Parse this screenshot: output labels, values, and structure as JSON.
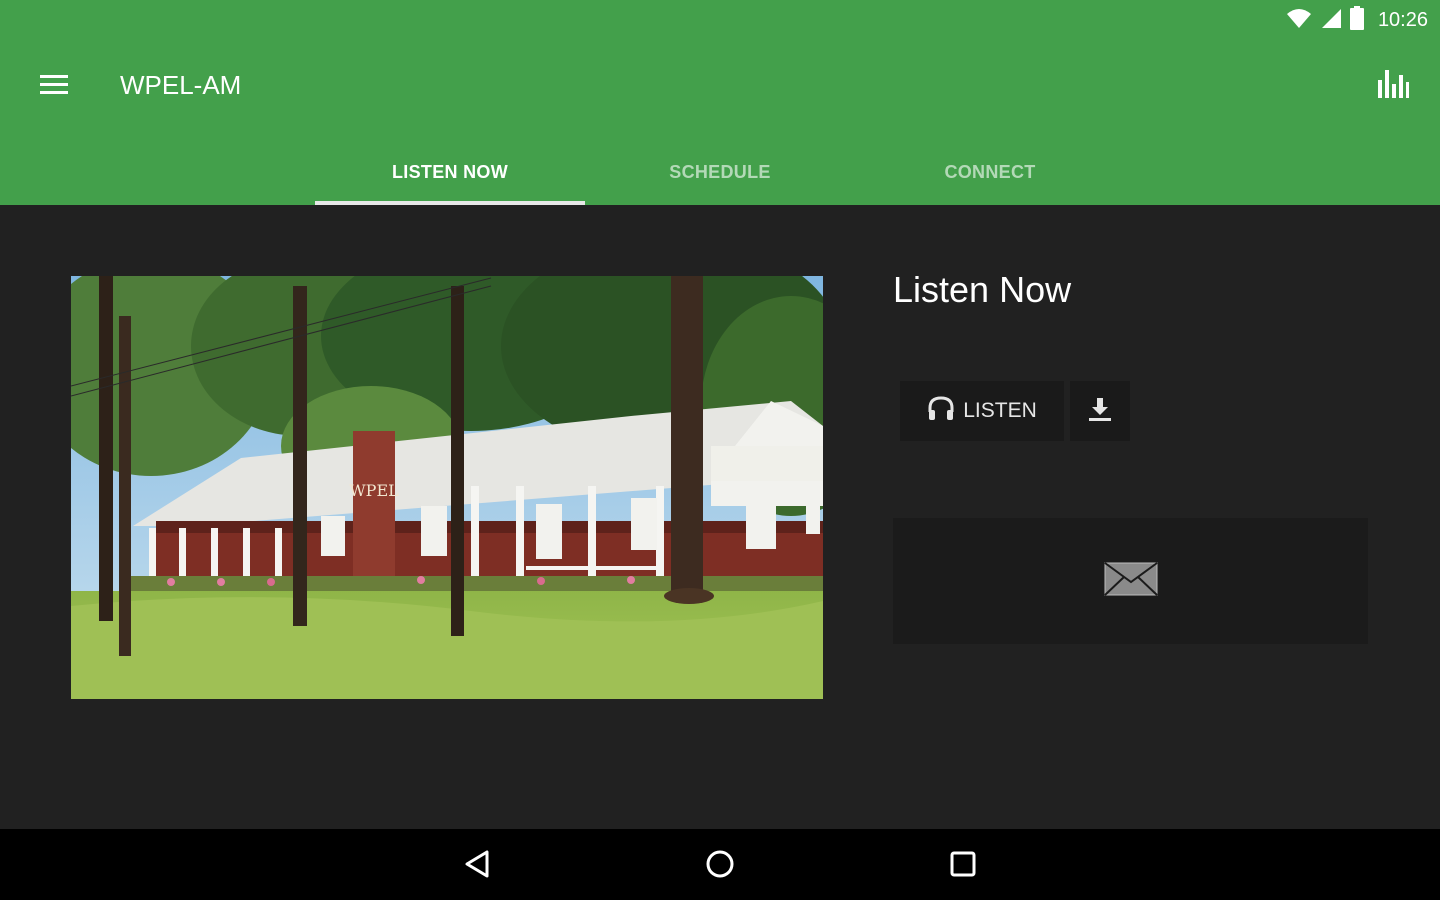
{
  "status_bar": {
    "time": "10:26",
    "icons": [
      "wifi-icon",
      "signal-icon",
      "battery-icon"
    ]
  },
  "toolbar": {
    "title": "WPEL-AM",
    "menu_icon": "menu-icon",
    "action_icon": "equalizer-icon"
  },
  "tabs": [
    {
      "label": "LISTEN NOW",
      "active": true
    },
    {
      "label": "SCHEDULE",
      "active": false
    },
    {
      "label": "CONNECT",
      "active": false
    }
  ],
  "main": {
    "title": "Listen Now",
    "image_sign": "WPEL",
    "listen_label": "LISTEN",
    "listen_icon": "headphones-icon",
    "download_icon": "download-icon",
    "email_icon": "email-icon"
  },
  "nav_bar": [
    "back-icon",
    "home-icon",
    "recents-icon"
  ],
  "colors": {
    "app_bar": "#43a04b",
    "background": "#212121",
    "button_background": "#1a1a1a",
    "nav_bar": "#000000"
  }
}
